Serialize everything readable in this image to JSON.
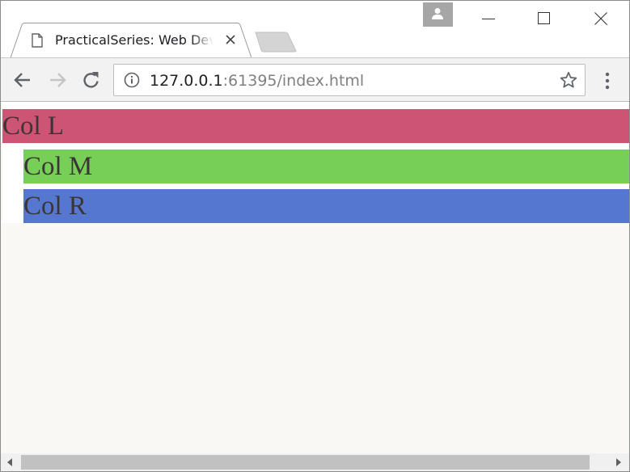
{
  "tab": {
    "title": "PracticalSeries: Web Development",
    "close_icon": "close-icon",
    "page_icon": "document-icon"
  },
  "window_controls": [
    "minimize-icon",
    "maximize-icon",
    "close-icon"
  ],
  "profile_icon": "person-icon",
  "toolbar": {
    "back_icon": "arrow-left-icon",
    "forward_icon": "arrow-right-icon",
    "reload_icon": "reload-icon",
    "menu_icon": "vertical-dots-icon"
  },
  "address": {
    "host": "127.0.0.1",
    "port_path": ":61395/index.html",
    "info_icon": "info-icon",
    "bookmark_icon": "star-icon"
  },
  "page": {
    "columns": [
      {
        "label": "Col L",
        "color": "#cd5474"
      },
      {
        "label": "Col M",
        "color": "#78cf57"
      },
      {
        "label": "Col R",
        "color": "#5577cf"
      }
    ],
    "background": "#f9f8f5"
  },
  "scrollbar_icons": [
    "triangle-left-icon",
    "triangle-right-icon"
  ]
}
